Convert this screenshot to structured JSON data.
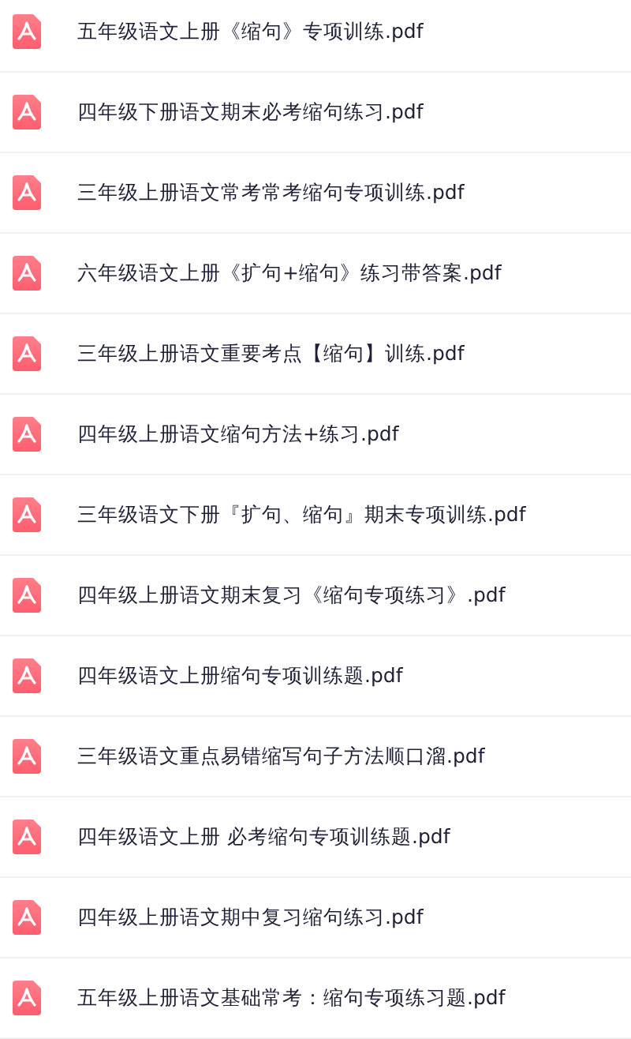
{
  "files": [
    {
      "name": "五年级语文上册《缩句》专项训练.pdf"
    },
    {
      "name": "四年级下册语文期末必考缩句练习.pdf"
    },
    {
      "name": "三年级上册语文常考常考缩句专项训练.pdf"
    },
    {
      "name": "六年级语文上册《扩句+缩句》练习带答案.pdf"
    },
    {
      "name": "三年级上册语文重要考点【缩句】训练.pdf"
    },
    {
      "name": "四年级上册语文缩句方法+练习.pdf"
    },
    {
      "name": "三年级语文下册『扩句、缩句』期末专项训练.pdf"
    },
    {
      "name": "四年级上册语文期末复习《缩句专项练习》.pdf"
    },
    {
      "name": "四年级语文上册缩句专项训练题.pdf"
    },
    {
      "name": "三年级语文重点易错缩写句子方法顺口溜.pdf"
    },
    {
      "name": "四年级语文上册 必考缩句专项训练题.pdf"
    },
    {
      "name": "四年级上册语文期中复习缩句练习.pdf"
    },
    {
      "name": "五年级上册语文基础常考：缩句专项练习题.pdf"
    }
  ]
}
